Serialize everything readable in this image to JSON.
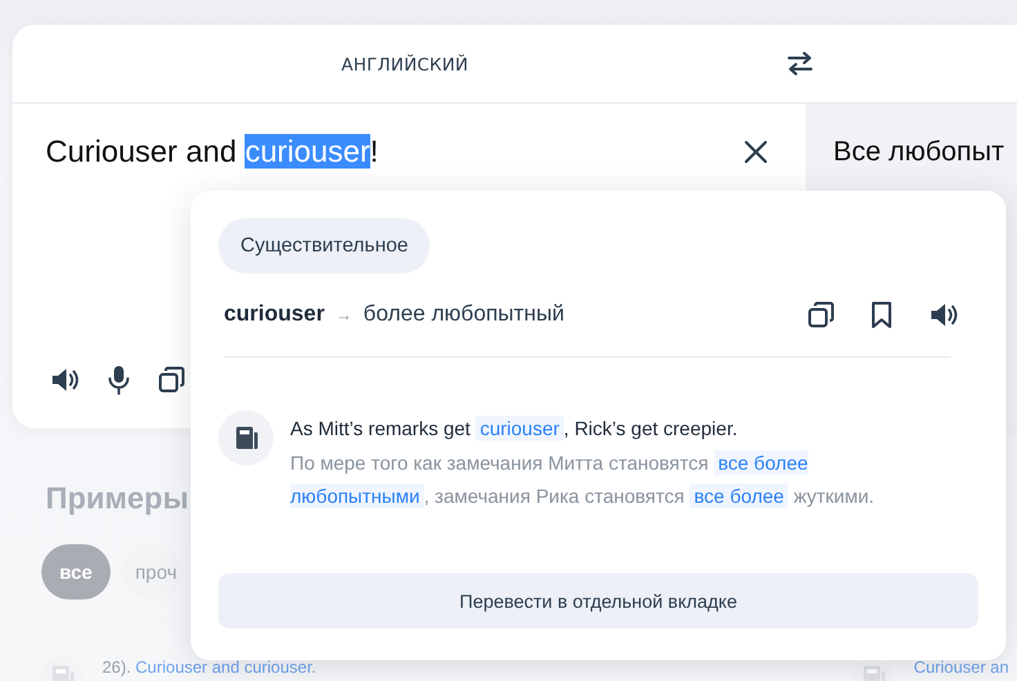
{
  "header": {
    "source_language": "АНГЛИЙСКИЙ"
  },
  "source": {
    "segments": [
      {
        "text": "Curiouser and ",
        "selected": false
      },
      {
        "text": "curiouser",
        "selected": true
      },
      {
        "text": "!",
        "selected": false
      }
    ]
  },
  "translation": {
    "text": "Все любопыт"
  },
  "examples": {
    "title": "Примеры",
    "filters": [
      {
        "label": "все",
        "selected": true
      },
      {
        "label": "проч",
        "selected": false
      }
    ],
    "rows": [
      {
        "segments": [
          {
            "text": "26). ",
            "kind": "plain"
          },
          {
            "text": "Curiouser and curiouser",
            "kind": "link"
          },
          {
            "text": ".",
            "kind": "plain"
          }
        ]
      },
      {
        "segments": [
          {
            "text": "Curiouser an",
            "kind": "link"
          }
        ]
      }
    ]
  },
  "popup": {
    "part_of_speech": "Существительное",
    "word": "curiouser",
    "arrow": "→",
    "translation": "более любопытный",
    "example": {
      "source": [
        {
          "text": "As Mitt’s remarks get ",
          "highlight": false
        },
        {
          "text": "curiouser",
          "highlight": true
        },
        {
          "text": ", Rick’s get creepier.",
          "highlight": false
        }
      ],
      "target": [
        {
          "text": "По мере того как замечания Митта становятся ",
          "highlight": false
        },
        {
          "text": "все более любопытными",
          "highlight": true
        },
        {
          "text": ", замечания Рика становятся ",
          "highlight": false
        },
        {
          "text": "все более",
          "highlight": true
        },
        {
          "text": " жуткими.",
          "highlight": false
        }
      ]
    },
    "button": "Перевести в отдельной вкладке"
  }
}
